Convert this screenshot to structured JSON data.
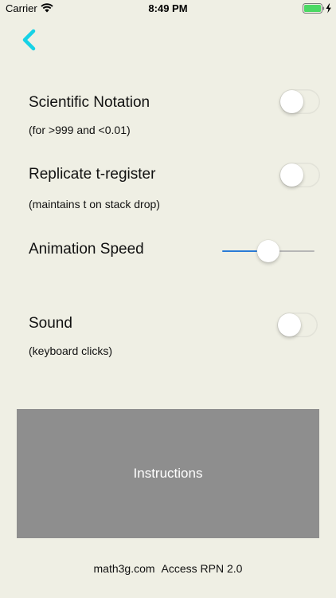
{
  "status_bar": {
    "carrier": "Carrier",
    "time": "8:49 PM",
    "battery_color": "#4cd964"
  },
  "nav": {
    "back_icon": "chevron-left-icon",
    "back_color": "#16d2e6"
  },
  "settings": {
    "scientific_notation": {
      "label": "Scientific Notation",
      "description": "(for >999 and <0.01)",
      "enabled": false
    },
    "replicate_t_register": {
      "label": "Replicate t-register",
      "description": "(maintains t on stack drop)",
      "enabled": false
    },
    "animation_speed": {
      "label": "Animation Speed",
      "value": 0.5
    },
    "sound": {
      "label": "Sound",
      "description": "(keyboard clicks)",
      "enabled": false
    }
  },
  "instructions_button": {
    "label": "Instructions",
    "background": "#8e8e8e"
  },
  "footer": {
    "site": "math3g.com",
    "app_version": "Access RPN 2.0"
  }
}
